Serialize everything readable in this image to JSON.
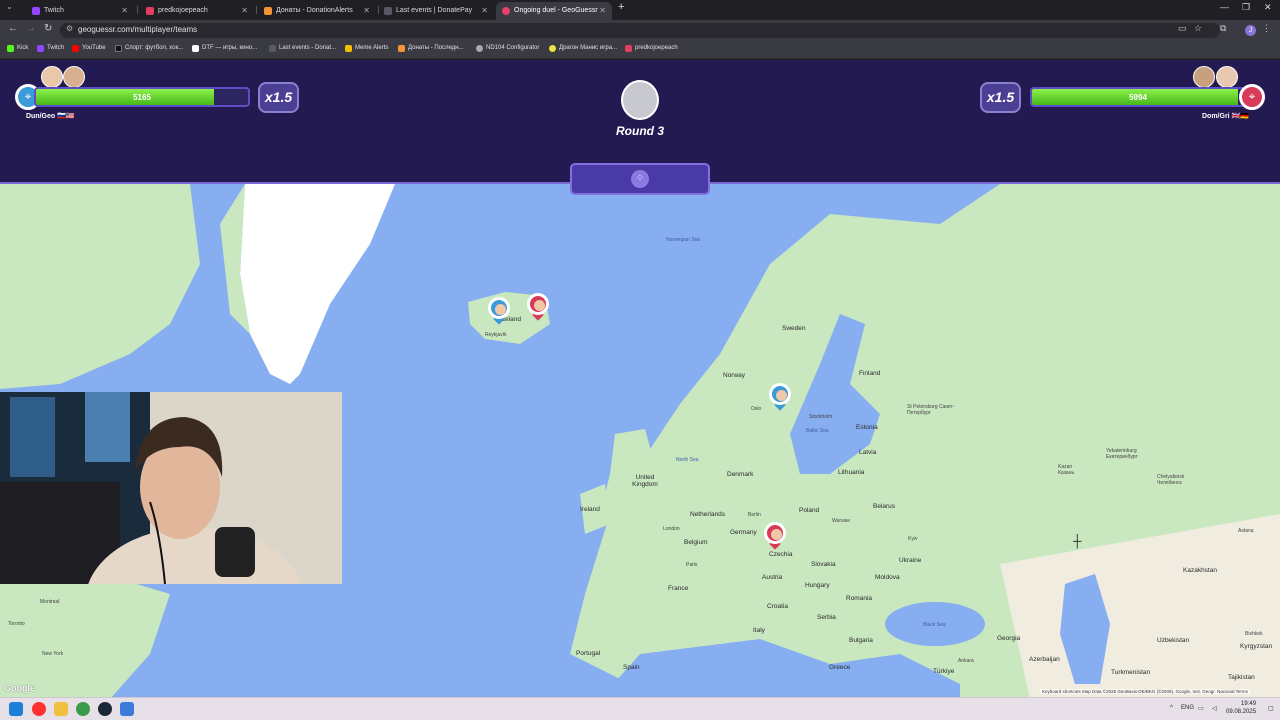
{
  "browser": {
    "tabs": [
      {
        "label": "Twitch",
        "color": "#9146ff",
        "active": false
      },
      {
        "label": "predkojoepeach",
        "color": "#e0405e",
        "active": false
      },
      {
        "label": "Донаты - DonationAlerts",
        "color": "#f29437",
        "active": false
      },
      {
        "label": "Last events | DonatePay",
        "color": "#5a5a64",
        "active": false
      },
      {
        "label": "Ongoing duel - GeoGuessr",
        "color": "#e8406a",
        "active": true
      }
    ],
    "url": "geoguessr.com/multiplayer/teams",
    "bookmarks": [
      {
        "label": "Kick",
        "color": "#53fc18"
      },
      {
        "label": "Twitch",
        "color": "#9146ff"
      },
      {
        "label": "YouTube",
        "color": "#ff0000"
      },
      {
        "label": "Спорт: футбол, хок...",
        "color": "#1a1a1a"
      },
      {
        "label": "DTF — игры, кино...",
        "color": "#ffffff"
      },
      {
        "label": "Last events - Donat...",
        "color": "#5a5a64"
      },
      {
        "label": "Meme Alerts",
        "color": "#f5c000"
      },
      {
        "label": "Донаты - Последн...",
        "color": "#f29437"
      },
      {
        "label": "ND104 Configurator",
        "color": "#aaaaaa"
      },
      {
        "label": "Драгон Манис игра...",
        "color": "#f0e040"
      },
      {
        "label": "predkojoepeach",
        "color": "#e0405e"
      }
    ],
    "profile_letter": "J"
  },
  "game": {
    "left_team": {
      "name": "Dun/Geo 🇷🇺🇺🇸",
      "health": 5165,
      "health_fraction": 0.84,
      "multiplier": "x1.5",
      "color": "#3a9bd8"
    },
    "right_team": {
      "name": "Dom/Gri 🇬🇧🇩🇪",
      "health": 5994,
      "health_fraction": 0.97,
      "multiplier": "x1.5",
      "color": "#d83a5a"
    },
    "round_label": "Round 3"
  },
  "map": {
    "countries": [
      "Sweden",
      "Norway",
      "Finland",
      "Estonia",
      "Latvia",
      "Lithuania",
      "Denmark",
      "United Kingdom",
      "Ireland",
      "Netherlands",
      "Belgium",
      "Germany",
      "Poland",
      "Belarus",
      "Czechia",
      "Slovakia",
      "Austria",
      "Hungary",
      "Romania",
      "Moldova",
      "Ukraine",
      "France",
      "Croatia",
      "Serbia",
      "Bulgaria",
      "Italy",
      "Portugal",
      "Spain",
      "Greece",
      "Türkiye",
      "Georgia",
      "Azerbaijan",
      "Kazakhstan",
      "Uzbekistan",
      "Turkmenistan",
      "Kyrgyzstan",
      "Tajikistan"
    ],
    "iceland_label": "Iceland",
    "seas": [
      "Norwegian Sea",
      "North Sea",
      "Baltic Sea",
      "Black Sea"
    ],
    "cities": [
      "Oslo",
      "Stockholm",
      "St Petersburg Санкт-Петербург",
      "Kazan Казань",
      "Yekaterinburg Екатеринбург",
      "Chelyabinsk Челябинск",
      "Astana",
      "Berlin",
      "Warsaw",
      "London",
      "Paris",
      "Kyiv",
      "Ankara",
      "Bishkek",
      "Montreal",
      "Toronto",
      "New York",
      "Reykjavík"
    ],
    "attribution": "Keyboard shortcuts   Map Data ©2025 GeoBasis-DE/BKG (©2009), Google, Inst. Geogr. Nacional   Terms",
    "google_label": "Google"
  },
  "taskbar": {
    "lang": "ENG",
    "time": "19:49",
    "date": "09.08.2025"
  }
}
